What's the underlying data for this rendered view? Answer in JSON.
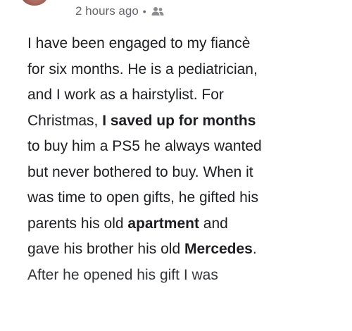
{
  "post": {
    "timestamp": "2 hours ago",
    "separator": "•",
    "audience_icon": "friends-icon",
    "lines": [
      [
        {
          "t": "I have been engaged to my fiancè",
          "b": false
        }
      ],
      [
        {
          "t": "for six months. He is a pediatrician,",
          "b": false
        }
      ],
      [
        {
          "t": "and I work as a hairstylist. For",
          "b": false
        }
      ],
      [
        {
          "t": "Christmas, ",
          "b": false
        },
        {
          "t": "I saved up for months",
          "b": true
        }
      ],
      [
        {
          "t": "to buy him a PS5 he always wanted",
          "b": false
        }
      ],
      [
        {
          "t": "but never bothered to buy. When it",
          "b": false
        }
      ],
      [
        {
          "t": "was time to open gifts, he gifted his",
          "b": false
        }
      ],
      [
        {
          "t": "parents his old ",
          "b": false
        },
        {
          "t": "apartment",
          "b": true
        },
        {
          "t": " and",
          "b": false
        }
      ],
      [
        {
          "t": "gave his brother his old ",
          "b": false
        },
        {
          "t": "Mercedes",
          "b": true
        },
        {
          "t": ".",
          "b": false
        }
      ],
      [
        {
          "t": "After he opened his gift I was",
          "b": false
        }
      ]
    ]
  }
}
